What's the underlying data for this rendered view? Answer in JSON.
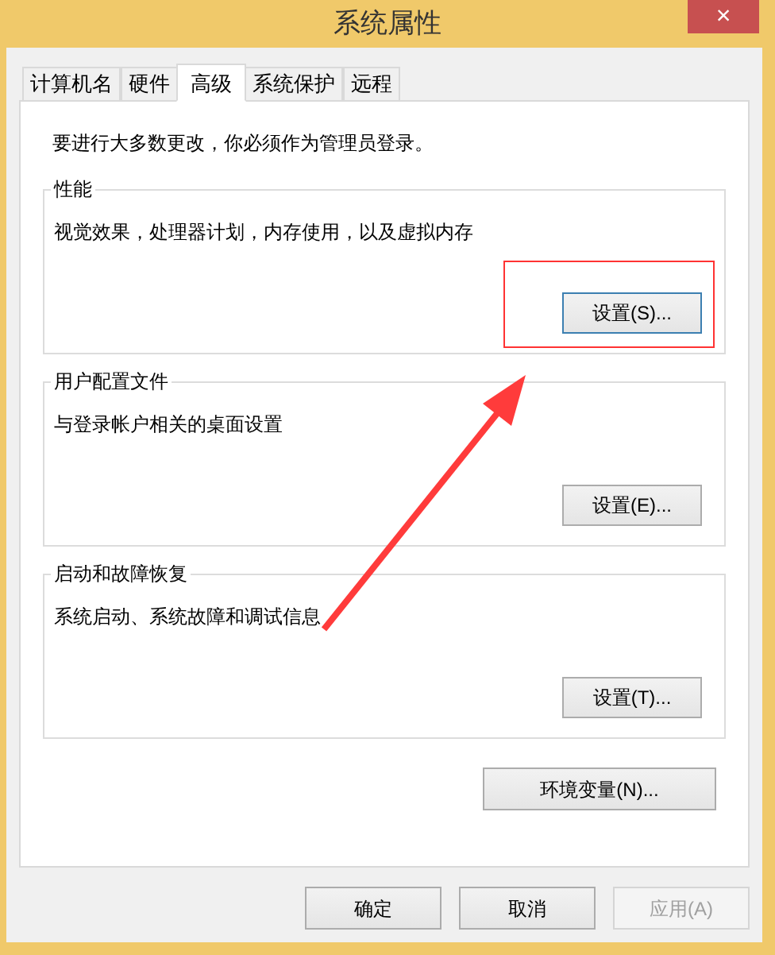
{
  "window": {
    "title": "系统属性",
    "close": "×"
  },
  "tabs": [
    {
      "label": "计算机名",
      "selected": false
    },
    {
      "label": "硬件",
      "selected": false
    },
    {
      "label": "高级",
      "selected": true
    },
    {
      "label": "系统保护",
      "selected": false
    },
    {
      "label": "远程",
      "selected": false
    }
  ],
  "notice": "要进行大多数更改，你必须作为管理员登录。",
  "groups": [
    {
      "title": "性能",
      "description": "视觉效果，处理器计划，内存使用，以及虚拟内存",
      "button": "设置(S)...",
      "focused": true,
      "highlighted": true
    },
    {
      "title": "用户配置文件",
      "description": "与登录帐户相关的桌面设置",
      "button": "设置(E)...",
      "focused": false,
      "highlighted": false
    },
    {
      "title": "启动和故障恢复",
      "description": "系统启动、系统故障和调试信息",
      "button": "设置(T)...",
      "focused": false,
      "highlighted": false
    }
  ],
  "environment_button": "环境变量(N)...",
  "buttons": [
    {
      "label": "确定",
      "disabled": false
    },
    {
      "label": "取消",
      "disabled": false
    },
    {
      "label": "应用(A)",
      "disabled": true
    }
  ]
}
